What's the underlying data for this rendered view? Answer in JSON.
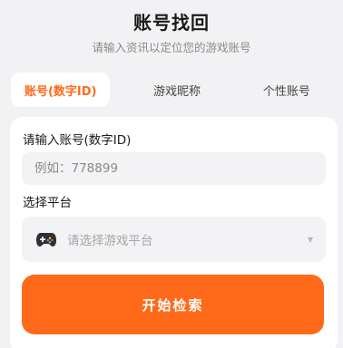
{
  "header": {
    "title": "账号找回",
    "subtitle": "请输入资讯以定位您的游戏账号"
  },
  "tabs": [
    {
      "label": "账号(数字ID)",
      "active": true
    },
    {
      "label": "游戏昵称",
      "active": false
    },
    {
      "label": "个性账号",
      "active": false
    }
  ],
  "form": {
    "account_label": "请输入账号(数字ID)",
    "account_placeholder": "例如：778899",
    "platform_label": "选择平台",
    "platform_placeholder": "请选择游戏平台",
    "platform_icon": "gamepad-icon",
    "submit_label": "开始检索"
  },
  "colors": {
    "accent": "#ff6a1a",
    "background": "#f2f2f4"
  }
}
